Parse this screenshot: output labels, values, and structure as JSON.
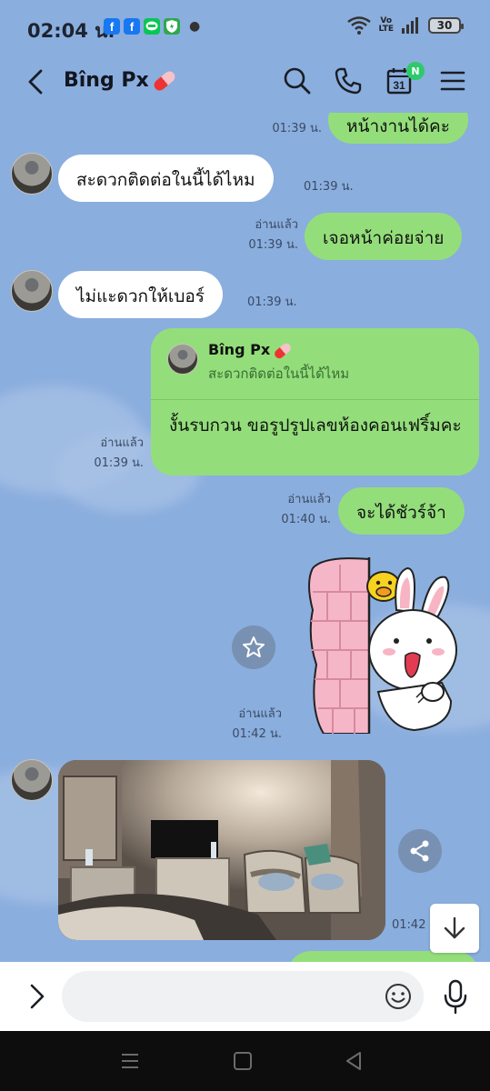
{
  "status_bar": {
    "time": "02:04 น.",
    "volte": "Vo\nLTE",
    "battery": "30",
    "notif_icons": [
      "facebook-icon",
      "facebook-icon",
      "line-icon",
      "shield-icon"
    ]
  },
  "header": {
    "contact_name": "Bîng Px",
    "calendar_day": "31",
    "calendar_badge": "N"
  },
  "messages": [
    {
      "id": "m0",
      "side": "out",
      "text": "หน้างานได้คะ",
      "time": "01:39 น.",
      "read": ""
    },
    {
      "id": "m1",
      "side": "in",
      "text": "สะดวกติดต่อในนี้ได้ไหม",
      "time": "01:39 น."
    },
    {
      "id": "m2",
      "side": "out",
      "text": "เจอหน้าค่อยจ่าย",
      "time": "01:39 น.",
      "read": "อ่านแล้ว"
    },
    {
      "id": "m3",
      "side": "in",
      "text": "ไม่แะดวกให้เบอร์",
      "time": "01:39 น."
    },
    {
      "id": "m4",
      "side": "out",
      "type": "reply",
      "reply_to_name": "Bîng Px",
      "reply_to_text": "สะดวกติดต่อในนี้ได้ไหม",
      "text": "งั้นรบกวน ขอรูปรูปเลขห้องคอนเฟริ์มคะ",
      "time": "01:39 น.",
      "read": "อ่านแล้ว"
    },
    {
      "id": "m5",
      "side": "out",
      "text": "จะได้ชัวร์จ้า",
      "time": "01:40 น.",
      "read": "อ่านแล้ว"
    },
    {
      "id": "m6",
      "side": "out",
      "type": "sticker",
      "sticker": "cony-sally-peek-sticker",
      "time": "01:42 น.",
      "read": "อ่านแล้ว"
    },
    {
      "id": "m7",
      "side": "in",
      "type": "photo",
      "photo": "hotel-room-photo",
      "time": "01:42"
    }
  ],
  "input": {
    "placeholder": ""
  },
  "colors": {
    "background": "#8aaede",
    "outgoing_bubble": "#93de7a",
    "incoming_bubble": "#ffffff",
    "navbar": "#0d0d0d"
  }
}
